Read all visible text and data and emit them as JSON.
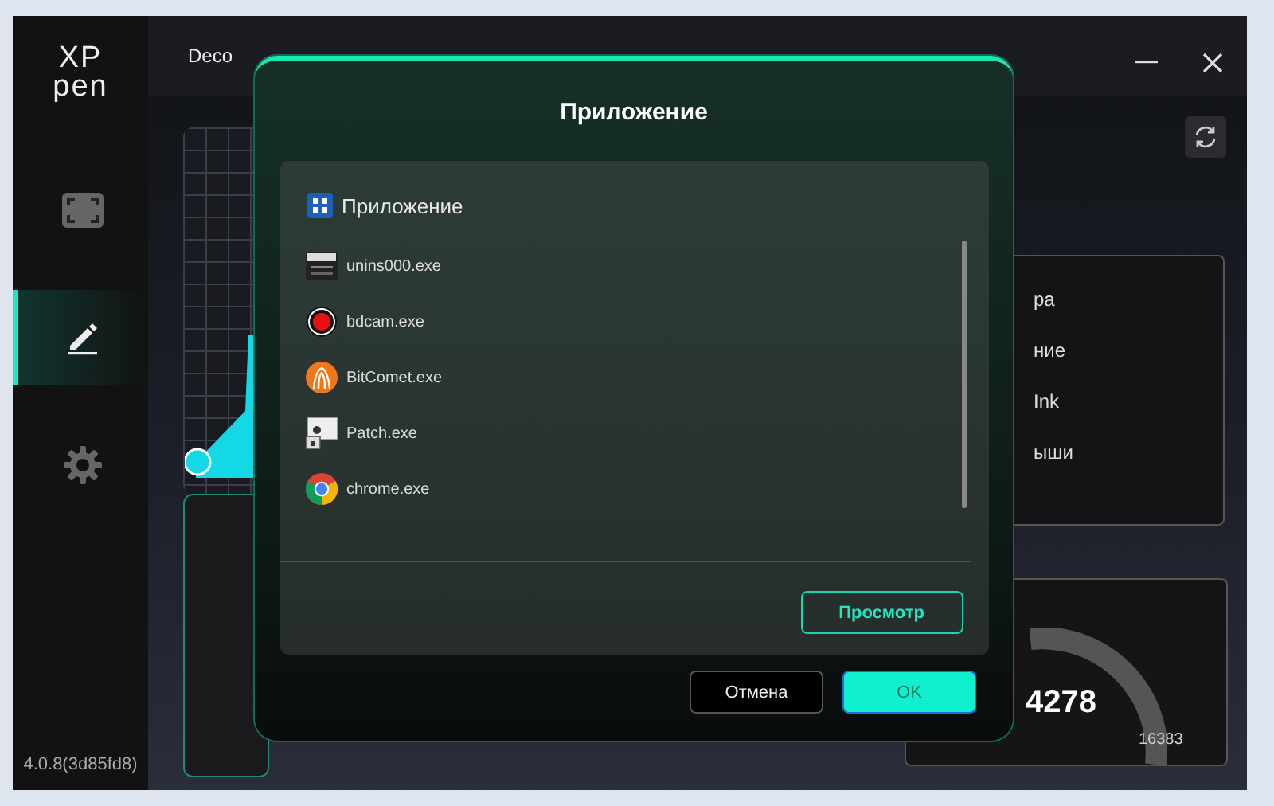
{
  "sidebar": {
    "logo": [
      "XP",
      "pen"
    ],
    "items": [
      {
        "kind": "screen",
        "selected": false
      },
      {
        "kind": "pen",
        "selected": true
      },
      {
        "kind": "settings",
        "selected": false
      }
    ],
    "version": "4.0.8(3d85fd8)"
  },
  "header": {
    "device": "Deco"
  },
  "settings_card": {
    "items": [
      "ра",
      "ние",
      "Ink",
      "ыши"
    ]
  },
  "pressure": {
    "value": "4278",
    "max": "16383"
  },
  "dialog": {
    "title": "Приложение",
    "list_header": "Приложение",
    "apps": [
      {
        "name": "unins000.exe",
        "kind": "installer"
      },
      {
        "name": "bdcam.exe",
        "kind": "record"
      },
      {
        "name": "BitComet.exe",
        "kind": "comet"
      },
      {
        "name": "Patch.exe",
        "kind": "patch"
      },
      {
        "name": "chrome.exe",
        "kind": "browser"
      }
    ],
    "browse": "Просмотр",
    "buttons": [
      {
        "label": "Отмена",
        "kind": "secondary"
      },
      {
        "label": "OK",
        "kind": "primary"
      }
    ]
  }
}
